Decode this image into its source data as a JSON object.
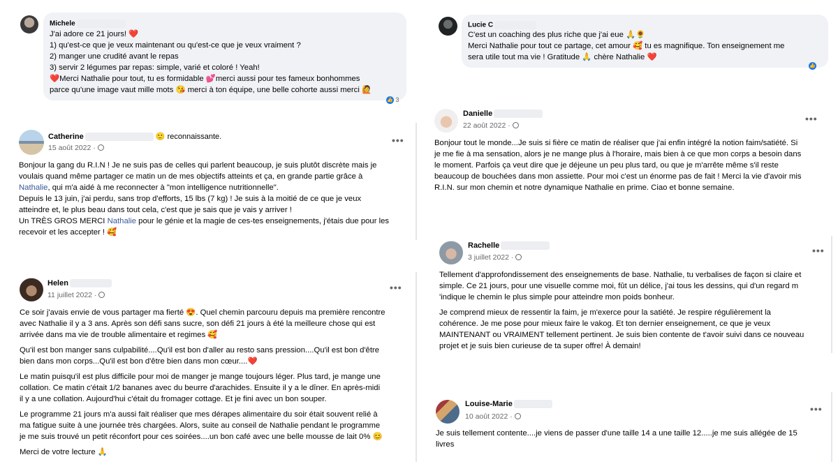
{
  "michele": {
    "name": "Michele",
    "lines": [
      "J'ai adore ce 21 jours! ❤️",
      "1) qu'est-ce que je veux maintenant ou qu'est-ce que je veux vraiment ?",
      "2) manger une crudité avant le repas",
      "3) servir 2 légumes par repas: simple, varié et coloré ! Yeah!",
      "❤️Merci Nathalie pour tout, tu es formidable 💕merci aussi pour tes fameux bonhommes",
      "parce qu'une image vaut mille mots 😘 merci à ton équipe, une belle cohorte aussi merci 🙋"
    ],
    "reactions": "3"
  },
  "lucie": {
    "name": "Lucie C",
    "lines": [
      "C'est un coaching des plus riche que j'ai eue 🙏🌻",
      "Merci Nathalie pour tout ce partage, cet amour 🥰 tu es magnifique. Ton enseignement me",
      "sera utile tout ma vie ! Gratitude 🙏 chère Nathalie ❤️"
    ]
  },
  "catherine": {
    "name": "Catherine",
    "feeling": "🙂 reconnaissante.",
    "date": "15 août 2022 ·",
    "lines": [
      "Bonjour la gang du R.I.N ! Je ne suis pas de celles qui parlent beaucoup, je suis plutôt discrète mais je",
      "voulais quand même partager ce matin un de mes objectifs atteints et ça, en grande partie grâce à",
      "Nathalie, qui m'a aidé à me reconnecter à \"mon intelligence nutritionnelle\".",
      "Depuis le 13 juin, j'ai perdu, sans trop d'efforts, 15 lbs (7 kg) ! Je suis à la moitié de ce que je veux",
      "atteindre et, le plus beau dans tout cela, c'est que je sais que je vais y arriver !",
      "Un TRÈS GROS MERCI Nathalie pour le génie et la magie de ces-tes enseignements, j'étais due pour les",
      "recevoir et les accepter ! 🥰"
    ]
  },
  "danielle": {
    "name": "Danielle",
    "date": "22 août 2022 ·",
    "lines": [
      "Bonjour tout le monde...Je suis si fière ce matin de réaliser que j'ai enfin intégré la notion faim/satiété. Si",
      "je me fie à ma sensation, alors je ne mange plus à l'horaire, mais bien à ce que mon corps a besoin dans",
      "le moment. Parfois ça veut dire que je déjeune un peu plus tard, ou que je m'arrête même s'il reste",
      "beaucoup de bouchées dans mon assiette. Pour moi c'est un énorme pas de fait ! Merci la vie d'avoir mis",
      "R.I.N. sur mon chemin et notre dynamique Nathalie en prime. Ciao et bonne semaine."
    ]
  },
  "helen": {
    "name": "Helen",
    "date": "11 juillet 2022 ·",
    "paragraphs": [
      [
        "Ce soir j'avais envie de vous partager ma fierté 😍.  Quel chemin parcouru depuis ma première rencontre",
        "avec Nathalie il y a 3 ans.  Après son défi sans sucre, son défi 21 jours à été la meilleure chose qui est",
        "arrivée dans ma vie de trouble alimentaire et regimes 🥰"
      ],
      [
        "Qu'il est bon manger sans culpabilité....Qu'il est bon d'aller au resto sans pression....Qu'il est bon d'être",
        "bien dans mon corps...Qu'il est bon d'être bien dans mon cœur....❤️"
      ],
      [
        "Le matin puisqu'il est plus difficile pour moi de manger je mange toujours léger.  Plus tard, je mange une",
        "collation.  Ce matin c'était 1/2 bananes avec du beurre d'arachides.  Ensuite il y a le dîner.  En après-midi",
        "il y a une collation.  Aujourd'hui c'était du fromager cottage.  Et je fini avec un bon souper."
      ],
      [
        "Le programme 21 jours m'a aussi fait réaliser que mes dérapes alimentaire du soir était souvent relié à",
        "ma fatigue suite à une journée très chargées. Alors, suite au conseil de Nathalie pendant le programme",
        "je me suis trouvé un petit réconfort pour ces soirées....un bon café avec une belle mousse de lait 0% 😊"
      ],
      [
        "Merci de votre lecture 🙏"
      ]
    ]
  },
  "rachelle": {
    "name": "Rachelle",
    "date": "3 juillet 2022 ·",
    "paragraphs": [
      [
        "Tellement d'approfondissement des enseignements de base. Nathalie, tu verbalises de façon si claire et",
        "simple. Ce 21 jours, pour une visuelle comme moi, fût un délice, j'ai tous les dessins, qui d'un regard m",
        "'indique le chemin le plus simple pour atteindre mon poids bonheur."
      ],
      [
        "Je comprend mieux de ressentir la faim, je m'exerce pour la satiété.  Je respire régulièrement la",
        "cohérence.  Je me pose pour mieux faire le vakog. Et ton dernier enseignement, ce que je veux",
        "MAINTENANT ou  VRAIMENT tellement pertinent. Je suis bien contente de t'avoir suivi dans ce nouveau",
        "projet et je suis bien curieuse de ta super offre! À demain!"
      ]
    ]
  },
  "louise": {
    "name": "Louise-Marie",
    "date": "10 août 2022 ·",
    "lines": [
      "Je suis tellement contente....je viens de passer d'une taille 14 a une taille 12.....je me suis allégée de 15",
      "livres"
    ]
  },
  "more_label": "•••",
  "colors": {
    "bubble": "#f0f2f5",
    "link": "#385898",
    "meta": "#65676b"
  }
}
